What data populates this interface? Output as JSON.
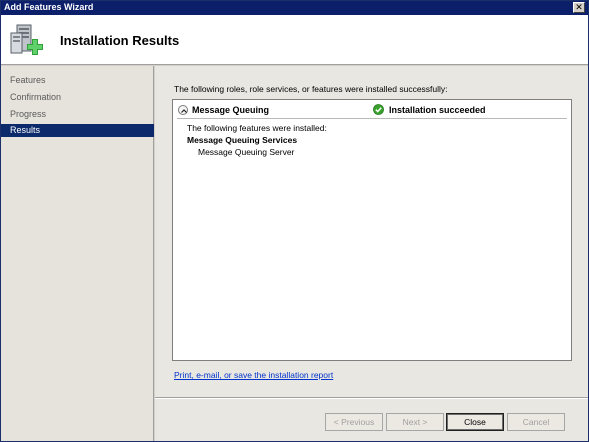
{
  "window": {
    "title": "Add Features Wizard",
    "close_glyph": "✕"
  },
  "header": {
    "title": "Installation Results",
    "icon": "server-add-feature-icon"
  },
  "sidebar": {
    "items": [
      {
        "label": "Features",
        "selected": false
      },
      {
        "label": "Confirmation",
        "selected": false
      },
      {
        "label": "Progress",
        "selected": false
      },
      {
        "label": "Results",
        "selected": true
      }
    ]
  },
  "main": {
    "intro": "The following roles, role services, or features were installed successfully:",
    "result": {
      "name": "Message Queuing",
      "status": "Installation succeeded",
      "status_icon": "check-circle-icon",
      "detail_intro": "The following features were installed:",
      "feature_group": "Message Queuing Services",
      "feature_item": "Message Queuing Server"
    },
    "report_link": "Print, e-mail, or save the installation report"
  },
  "buttons": {
    "previous": "< Previous",
    "next": "Next >",
    "close": "Close",
    "cancel": "Cancel"
  },
  "colors": {
    "titlebar": "#0c1f6b",
    "selected_nav": "#0c2a6b",
    "link": "#0033cc",
    "success": "#3aa12e"
  }
}
